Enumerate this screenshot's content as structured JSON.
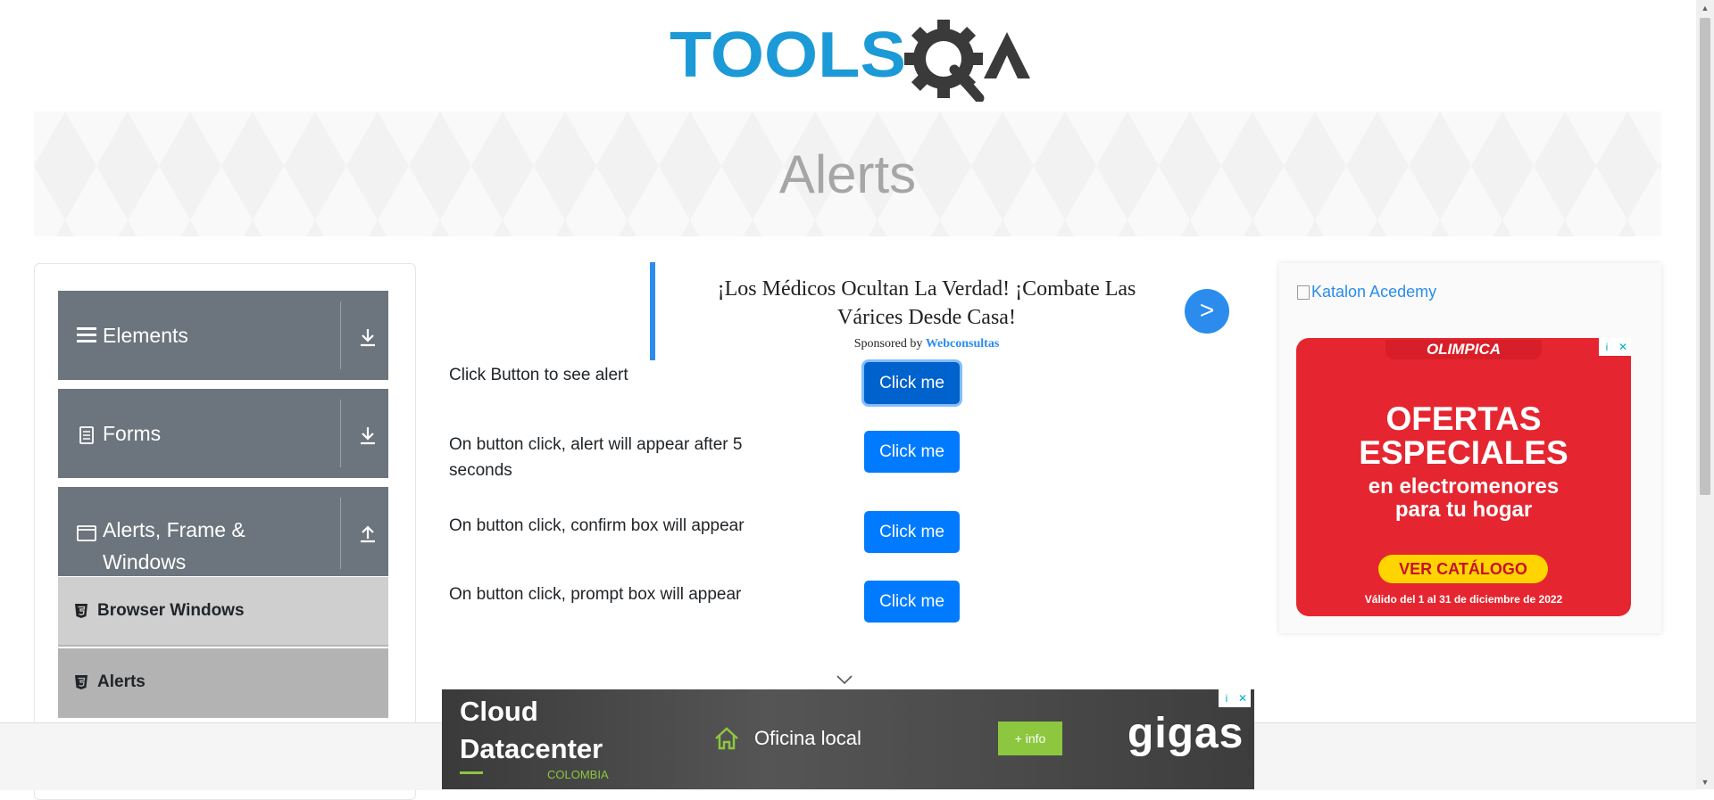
{
  "header": {
    "logo_text": "TOOLSQA"
  },
  "banner": {
    "title": "Alerts"
  },
  "sidebar": {
    "groups": [
      {
        "label": "Elements",
        "icon": "hamburger-icon",
        "state": "collapsed"
      },
      {
        "label": "Forms",
        "icon": "document-icon",
        "state": "collapsed"
      },
      {
        "label": "Alerts, Frame & Windows",
        "icon": "window-icon",
        "state": "expanded"
      }
    ],
    "items": [
      {
        "label": "Browser Windows",
        "icon": "html-badge-icon",
        "active": false
      },
      {
        "label": "Alerts",
        "icon": "html-badge-icon",
        "active": true
      }
    ]
  },
  "ad": {
    "headline": "¡Los Médicos Ocultan La Verdad! ¡Combate Las Várices Desde Casa!",
    "sponsored_prefix": "Sponsored by",
    "sponsor": "Webconsultas",
    "arrow": ">"
  },
  "alerts": {
    "rows": [
      {
        "label": "Click Button to see alert",
        "button": "Click me"
      },
      {
        "label": "On button click, alert will appear after 5 seconds",
        "button": "Click me"
      },
      {
        "label": "On button click, confirm box will appear",
        "button": "Click me"
      },
      {
        "label": "On button click, prompt box will appear",
        "button": "Click me"
      }
    ]
  },
  "right_ad": {
    "broken_image_alt": "Katalon Acedemy",
    "brand": "OLIMPICA",
    "headline_1": "OFERTAS",
    "headline_2": "ESPECIALES",
    "sub_1": "en electromenores",
    "sub_2": "para tu hogar",
    "cta": "VER CATÁLOGO",
    "fine_print": "Válido del 1 al 31 de diciembre de 2022",
    "adchoice_info": "i",
    "adchoice_close": "✕"
  },
  "bottom_ad": {
    "line_1": "Cloud",
    "line_2": "Datacenter",
    "country": "COLOMBIA",
    "offer": "Oficina local",
    "cta": "+ info",
    "brand": "gigas"
  },
  "colors": {
    "primary": "#007bff",
    "sidebar_group": "#6c757d",
    "accent_blue": "#2b8ced",
    "logo_blue": "#1b9ad7",
    "logo_dark": "#3a3a3a",
    "promo_red": "#e52630",
    "promo_yellow": "#ffd400",
    "gigas_green": "#8dc63f"
  }
}
